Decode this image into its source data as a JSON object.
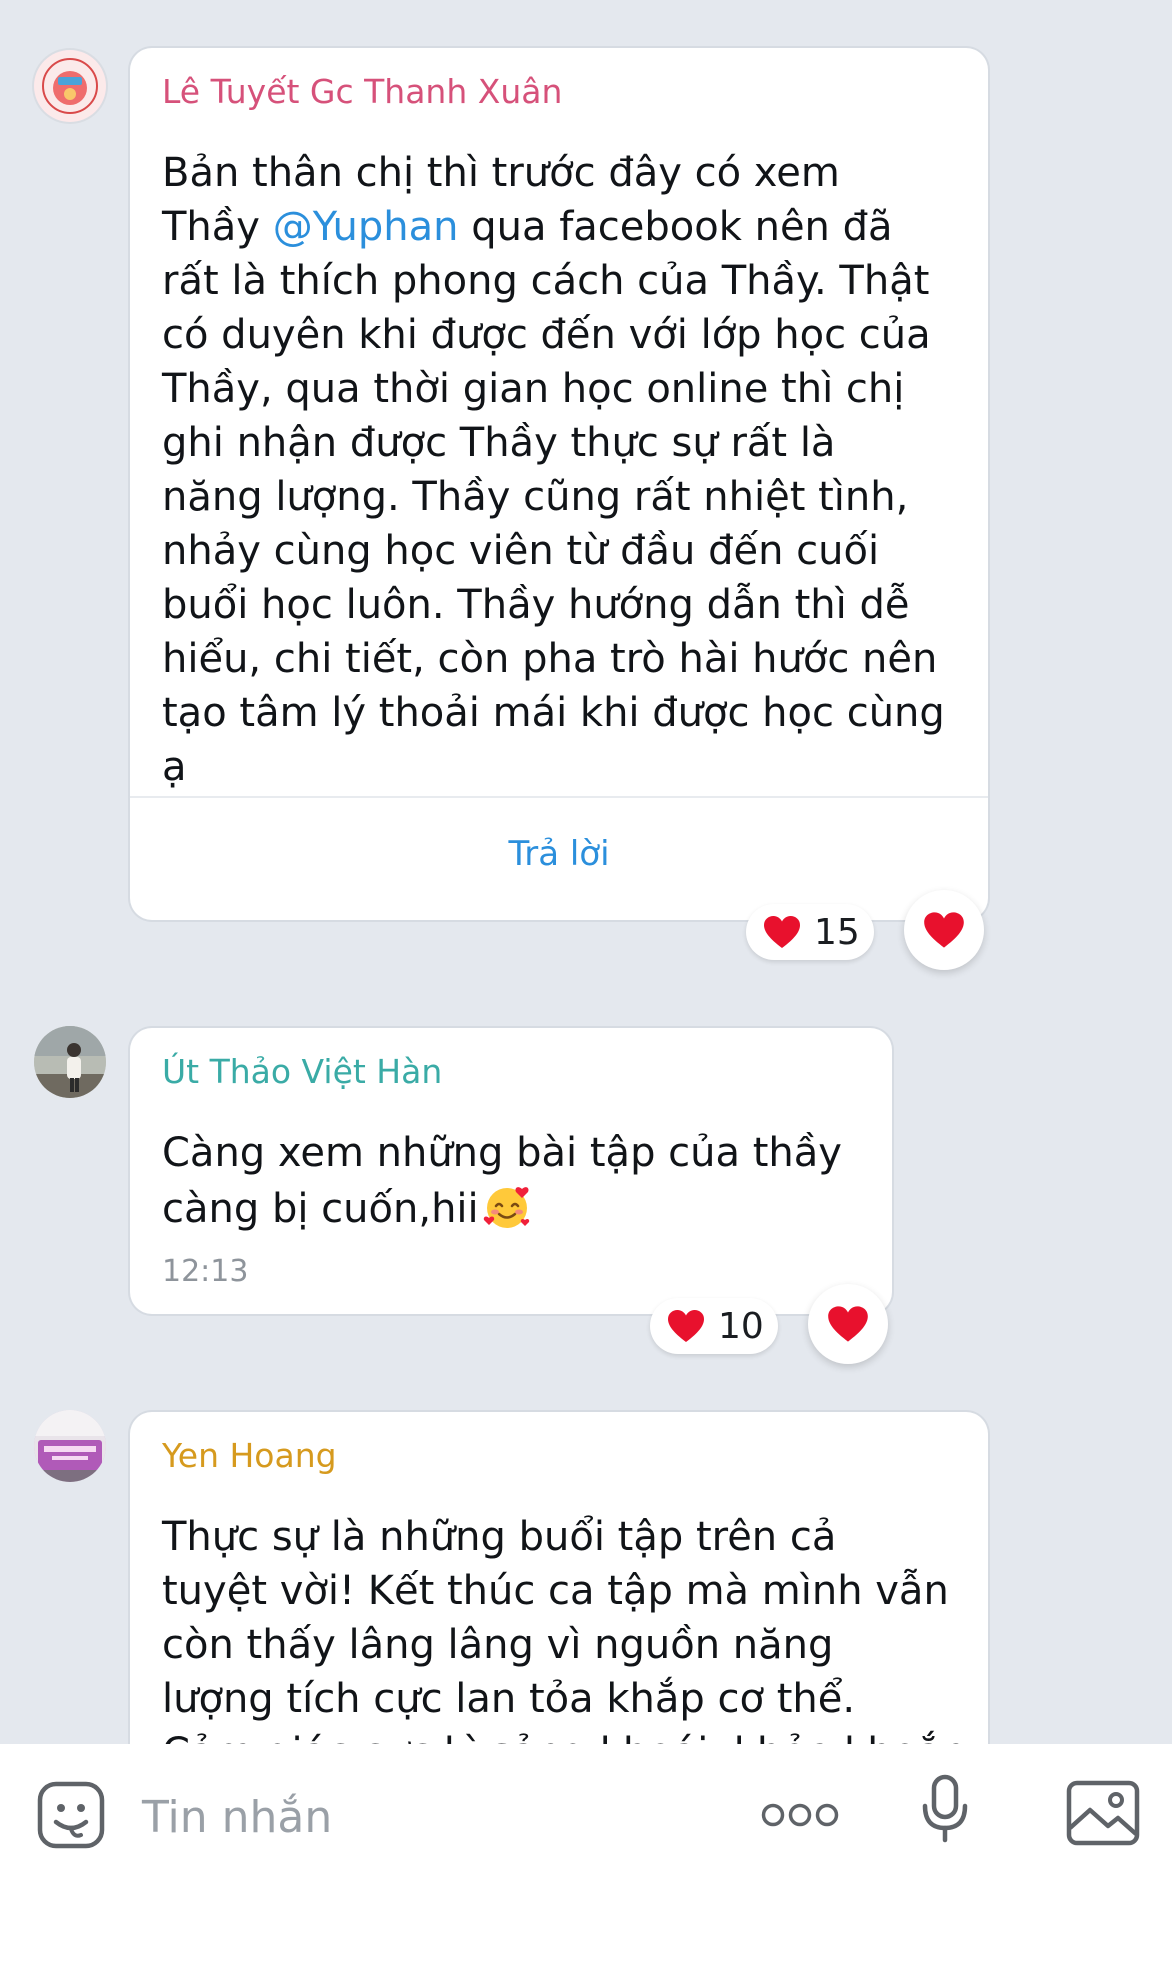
{
  "messages": [
    {
      "sender": "Lê Tuyết Gc Thanh Xuân",
      "sender_color": "#d6517a",
      "lines": [
        "Bản thân chị thì trước đây có xem",
        "qua facebook nên đã",
        "rất là thích phong cách của Thầy. Thật",
        "có duyên khi được đến với lớp học của",
        "Thầy, qua thời gian học online thì chị",
        "ghi nhận được Thầy thực sự rất là",
        "năng lượng. Thầy cũng rất nhiệt tình,",
        "nhảy cùng học viên từ đầu đến cuối",
        "buổi học luôn. Thầy hướng dẫn thì dễ",
        "hiểu, chi tiết, còn pha trò hài hước nên",
        "tạo tâm lý thoải mái khi được học cùng",
        "ạ"
      ],
      "line2_prefix": "Thầy",
      "mention": "@Yuphan",
      "reply_label": "Trả lời",
      "reaction_count": "15"
    },
    {
      "sender": "Út Thảo Việt Hàn",
      "sender_color": "#3aaba6",
      "lines": [
        "Càng xem những bài tập của thầy",
        "càng bị cuốn,hii"
      ],
      "time": "12:13",
      "reaction_count": "10"
    },
    {
      "sender": "Yen Hoang",
      "sender_color": "#d69a1e",
      "lines": [
        "Thực sự là những  buổi tập trên cả",
        "tuyệt vời! Kết thúc ca tập mà mình vẫn",
        "còn thấy lâng lâng vì nguồn năng",
        "lượng tích cực lan tỏa khắp cơ thể.",
        "Cảm giác cực kì sảng khoái, khỏe khoắn"
      ]
    }
  ],
  "input": {
    "placeholder": "Tin nhắn"
  },
  "colors": {
    "heart": "#e8112d",
    "accent": "#2b8fdc",
    "background": "#e4e8ee"
  }
}
